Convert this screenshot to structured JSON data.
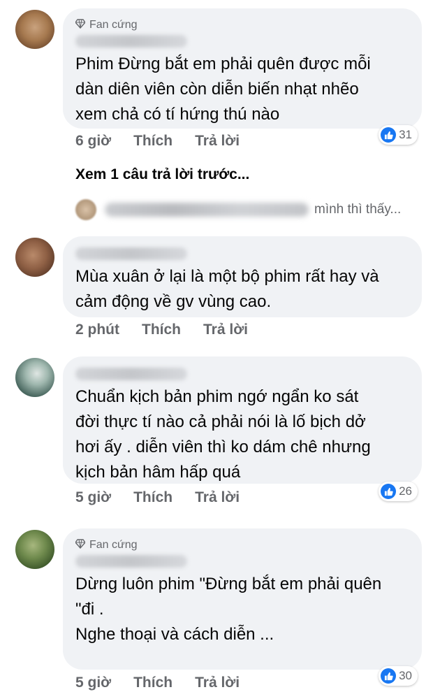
{
  "comments": [
    {
      "badge": "Fan cứng",
      "text_lines": [
        "Phim Đừng bắt em phải quên được mỗi",
        "dàn diên viên còn diễn biến nhạt nhẽo",
        "xem chả có tí hứng thú nào"
      ],
      "time": "6 giờ",
      "like_label": "Thích",
      "reply_label": "Trả lời",
      "reaction_count": "31"
    },
    {
      "badge": "",
      "text_lines": [
        "Mùa xuân ở lại là một bộ phim rất hay và",
        "cảm động về gv vùng cao."
      ],
      "time": "2 phút",
      "like_label": "Thích",
      "reply_label": "Trả lời",
      "reaction_count": ""
    },
    {
      "badge": "",
      "text_lines": [
        "Chuẩn kịch bản phim ngớ ngẩn ko sát",
        "đời thực tí nào cả phải nói là lố bịch dở",
        "hơi ấy . diễn viên thì ko dám chê nhưng",
        "kịch bản hâm hấp quá"
      ],
      "time": "5 giờ",
      "like_label": "Thích",
      "reply_label": "Trả lời",
      "reaction_count": "26"
    },
    {
      "badge": "Fan cứng",
      "text_lines": [
        "Dừng luôn phim \"Đừng bắt em phải quên",
        "\"đi .",
        "Nghe thoại và cách diễn ..."
      ],
      "time": "5 giờ",
      "like_label": "Thích",
      "reply_label": "Trả lời",
      "reaction_count": "30"
    }
  ],
  "view_previous": "Xem 1 câu trả lời trước...",
  "reply_preview_text": "mình thì thấy...",
  "colors": {
    "bubble": "#f0f2f5",
    "like_blue": "#1877f2",
    "meta_gray": "#65676b"
  },
  "icons": {
    "badge": "diamond-icon",
    "reaction": "like-icon"
  }
}
